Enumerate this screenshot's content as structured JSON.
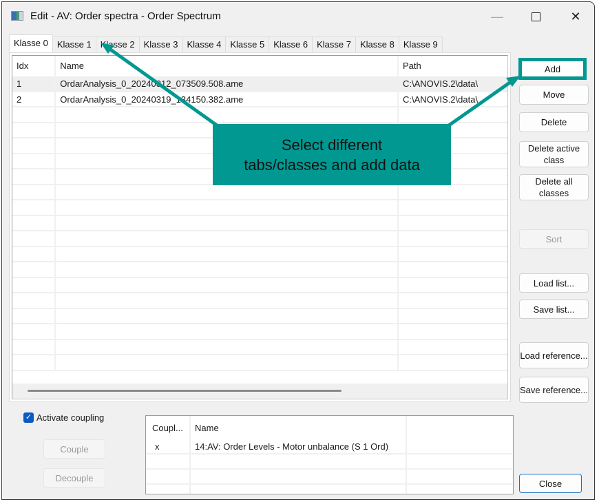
{
  "window": {
    "title": "Edit - AV: Order spectra - Order Spectrum",
    "icon": "app-window-icon",
    "controls": {
      "minimize": "—",
      "maximize": "□",
      "close": "✕"
    }
  },
  "tabs": [
    {
      "label": "Klasse 0",
      "active": true
    },
    {
      "label": "Klasse 1",
      "active": false
    },
    {
      "label": "Klasse 2",
      "active": false
    },
    {
      "label": "Klasse 3",
      "active": false
    },
    {
      "label": "Klasse 4",
      "active": false
    },
    {
      "label": "Klasse 5",
      "active": false
    },
    {
      "label": "Klasse 6",
      "active": false
    },
    {
      "label": "Klasse 7",
      "active": false
    },
    {
      "label": "Klasse 8",
      "active": false
    },
    {
      "label": "Klasse 9",
      "active": false
    }
  ],
  "file_table": {
    "columns": [
      "Idx",
      "Name",
      "Path"
    ],
    "rows": [
      {
        "idx": "1",
        "name": "OrdarAnalysis_0_20240312_073509.508.ame",
        "path": "C:\\ANOVIS.2\\data\\",
        "selected": true
      },
      {
        "idx": "2",
        "name": "OrdarAnalysis_0_20240319_134150.382.ame",
        "path": "C:\\ANOVIS.2\\data\\",
        "selected": false
      }
    ],
    "empty_rows": 17
  },
  "side_buttons": {
    "add": "Add",
    "move": "Move",
    "delete": "Delete",
    "delete_active_class": "Delete active class",
    "delete_all_classes": "Delete all classes",
    "sort": "Sort",
    "load_list": "Load list...",
    "save_list": "Save list...",
    "load_reference": "Load reference...",
    "save_reference": "Save reference..."
  },
  "coupling": {
    "checkbox_label": "Activate coupling",
    "checked": true,
    "couple_button": "Couple",
    "decouple_button": "Decouple",
    "columns": [
      "Coupl...",
      "Name",
      ""
    ],
    "rows": [
      {
        "coupled": "x",
        "name": "14:AV: Order Levels - Motor unbalance (S 1 Ord)"
      }
    ],
    "empty_rows": 3
  },
  "close_button": "Close",
  "annotation": {
    "line1": "Select different",
    "line2": "tabs/classes and add data",
    "color": "#009891"
  }
}
